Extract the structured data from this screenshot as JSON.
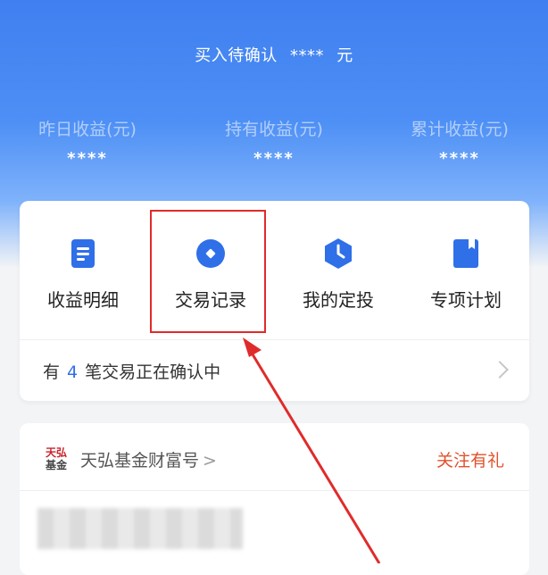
{
  "header": {
    "pending_label": "买入待确认",
    "pending_value": "****",
    "pending_unit": "元"
  },
  "stats": [
    {
      "label": "昨日收益(元)",
      "value": "****"
    },
    {
      "label": "持有收益(元)",
      "value": "****"
    },
    {
      "label": "累计收益(元)",
      "value": "****"
    }
  ],
  "quick_actions": [
    {
      "label": "收益明细",
      "icon": "document-icon"
    },
    {
      "label": "交易记录",
      "icon": "record-icon"
    },
    {
      "label": "我的定投",
      "icon": "clock-hexagon-icon"
    },
    {
      "label": "专项计划",
      "icon": "bookmark-icon"
    }
  ],
  "confirm": {
    "prefix": "有",
    "count": "4",
    "suffix": "笔交易正在确认中"
  },
  "fund": {
    "logo_line1": "天弘",
    "logo_line2": "基金",
    "name": "天弘基金财富号",
    "arrow": ">",
    "follow_label": "关注有礼"
  },
  "colors": {
    "primary": "#3f7ff0",
    "accent_red": "#e02b2b",
    "follow_orange": "#e0522c"
  }
}
